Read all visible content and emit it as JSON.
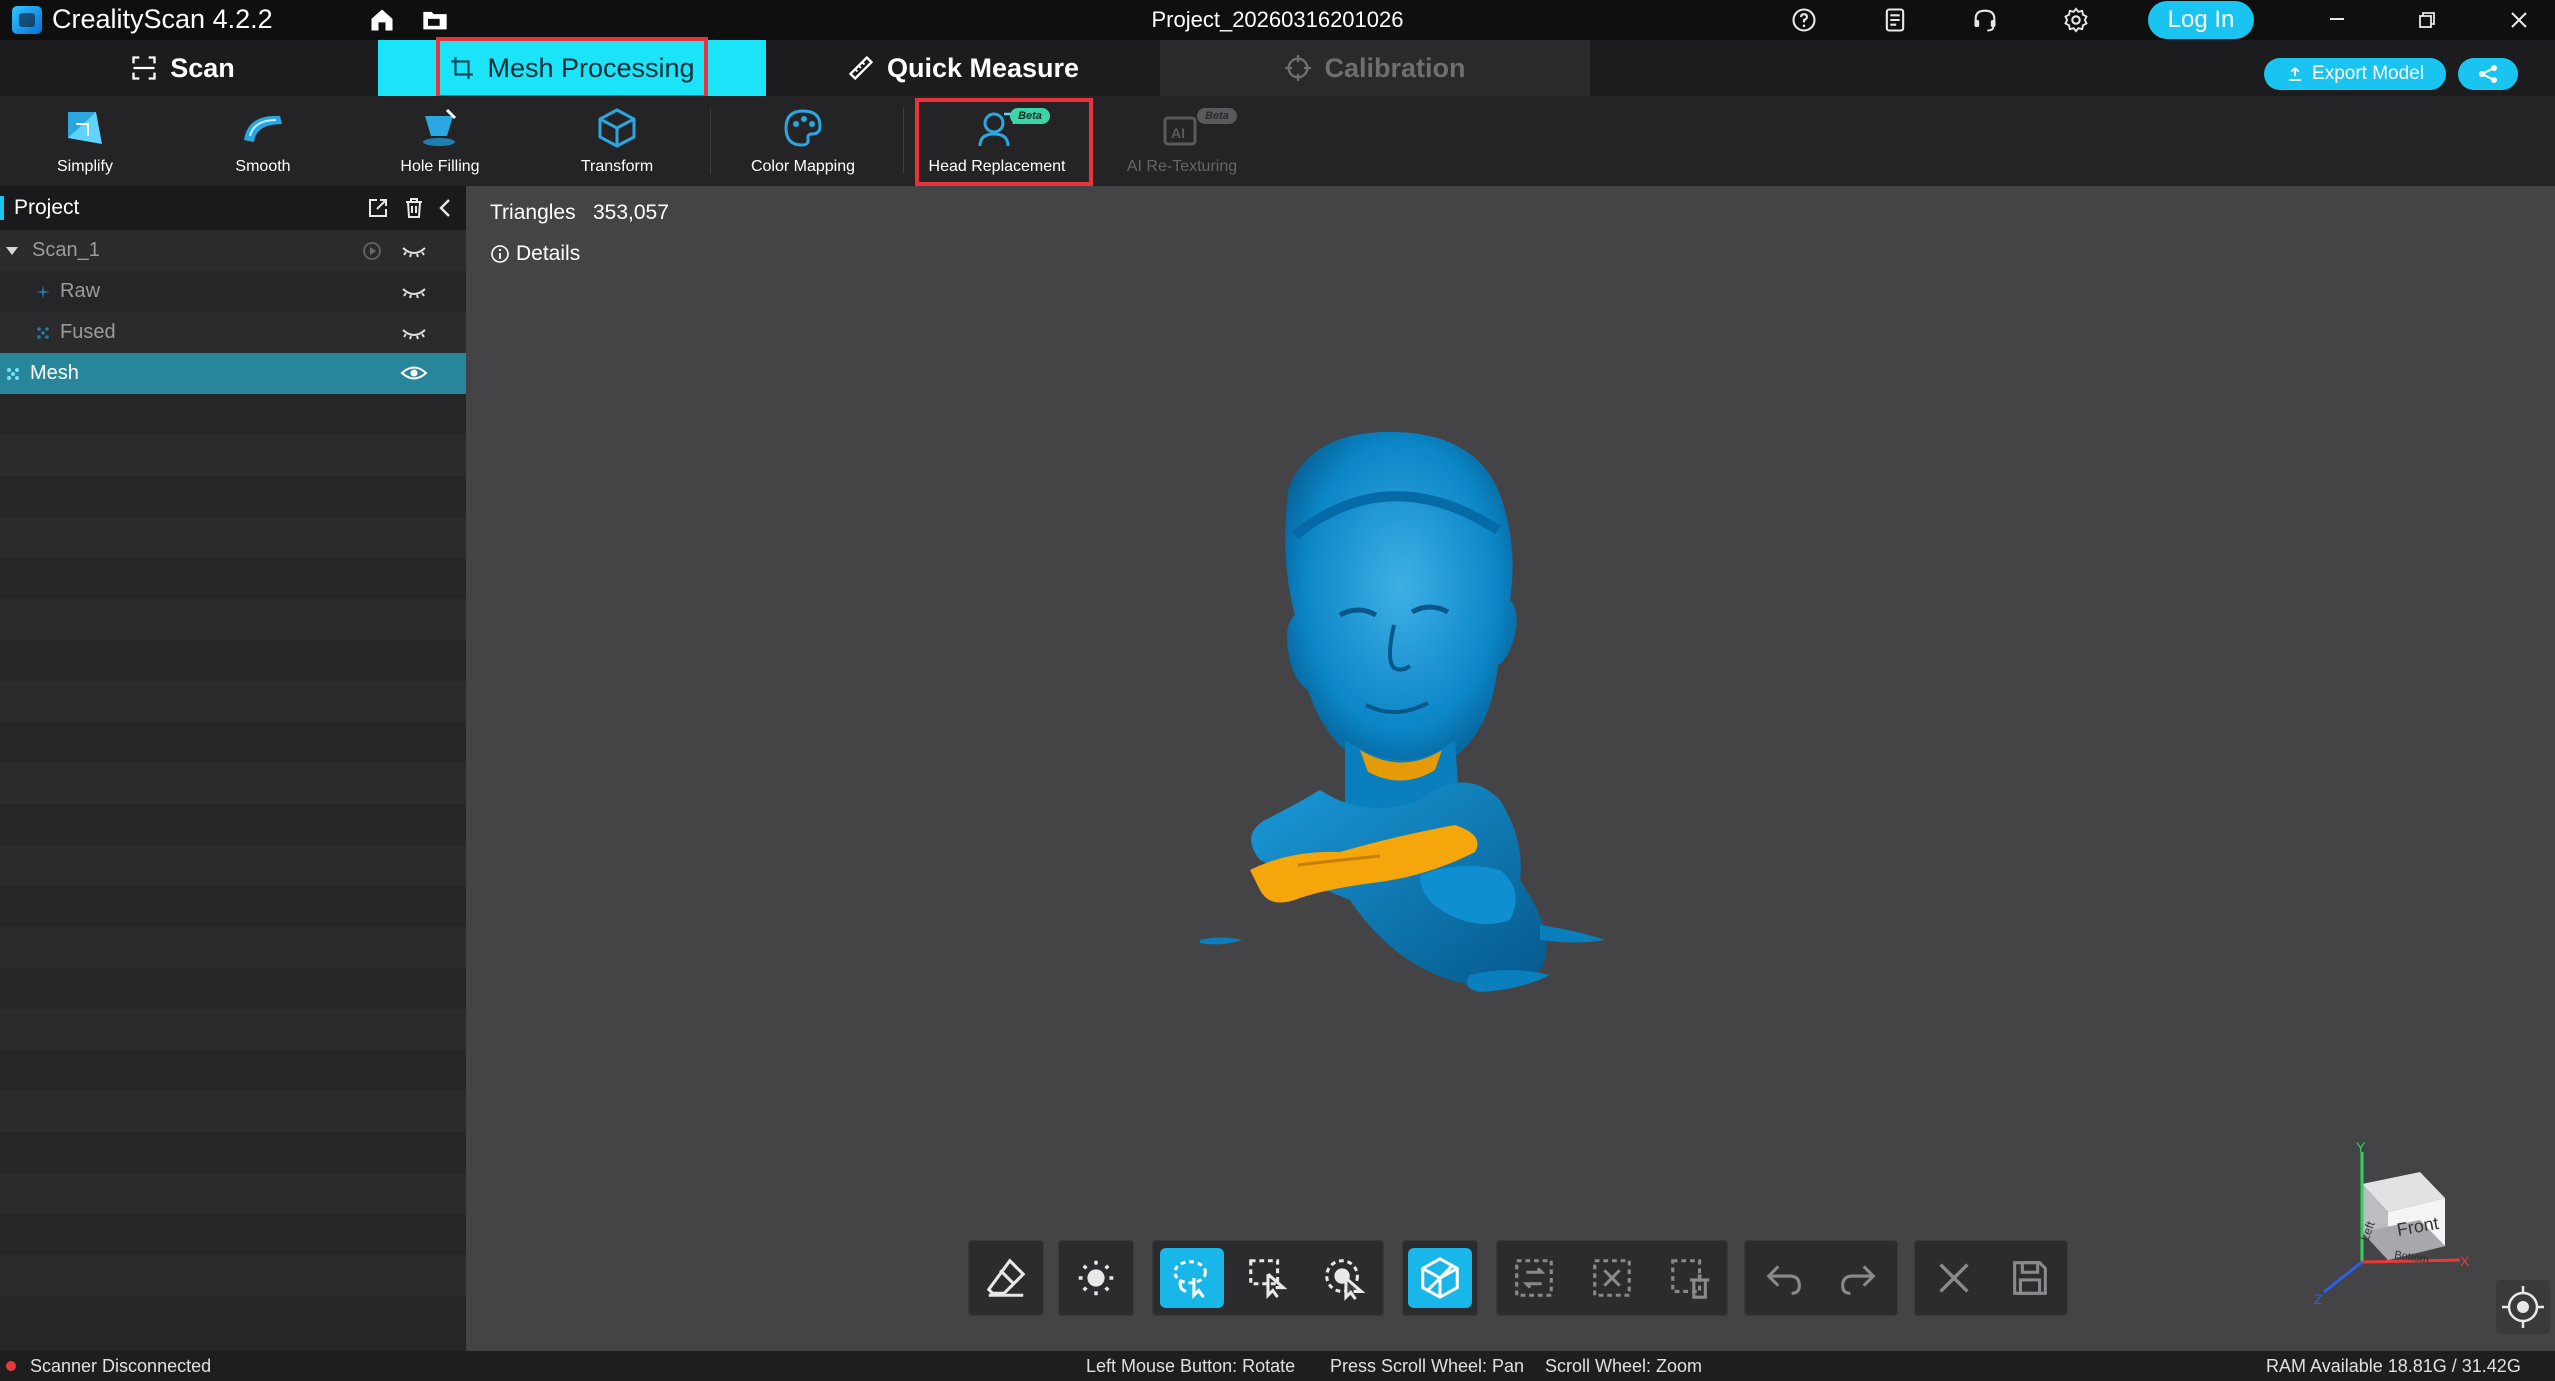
{
  "app": {
    "title": "CrealityScan 4.2.2",
    "project_name": "Project_20260316201026",
    "login_label": "Log In"
  },
  "tabs": [
    {
      "label": "Scan"
    },
    {
      "label": "Mesh Processing"
    },
    {
      "label": "Quick Measure"
    },
    {
      "label": "Calibration"
    }
  ],
  "export": {
    "label": "Export Model"
  },
  "tools": [
    {
      "label": "Simplify"
    },
    {
      "label": "Smooth"
    },
    {
      "label": "Hole Filling"
    },
    {
      "label": "Transform"
    },
    {
      "label": "Color Mapping"
    },
    {
      "label": "Head Replacement",
      "badge": "Beta"
    },
    {
      "label": "AI Re-Texturing",
      "badge": "Beta"
    }
  ],
  "sidebar": {
    "title": "Project",
    "items": [
      {
        "label": "Scan_1"
      },
      {
        "label": "Raw"
      },
      {
        "label": "Fused"
      },
      {
        "label": "Mesh"
      }
    ]
  },
  "viewport": {
    "triangles_label": "Triangles",
    "triangles_value": "353,057",
    "details_label": "Details",
    "gizmo": {
      "y": "Y",
      "x": "X",
      "z": "Z",
      "front": "Front",
      "left": "Left",
      "bottom": "Bottom"
    }
  },
  "status": {
    "scanner": "Scanner Disconnected",
    "hint_rotate": "Left Mouse Button: Rotate",
    "hint_pan": "Press Scroll Wheel: Pan",
    "hint_zoom": "Scroll Wheel: Zoom",
    "ram": "RAM Available 18.81G / 31.42G"
  },
  "colors": {
    "accent": "#19c5f0",
    "tab_active": "#1be3f8",
    "highlight_box": "#e8323c",
    "mesh": "#0b8fd0",
    "mesh_patch": "#f5a60a"
  }
}
